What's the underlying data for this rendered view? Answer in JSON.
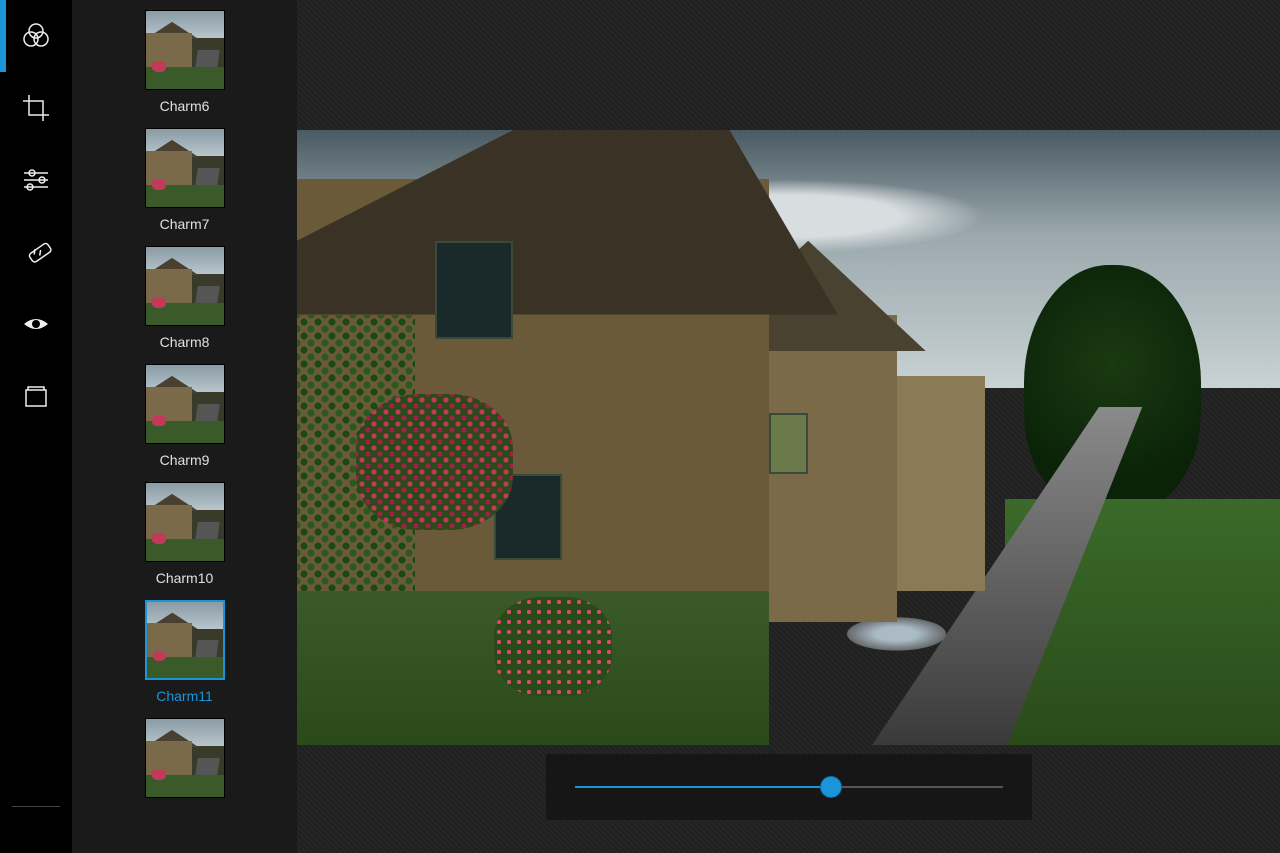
{
  "rail": {
    "items": [
      {
        "name": "filters-icon",
        "active": true
      },
      {
        "name": "crop-icon",
        "active": false
      },
      {
        "name": "adjust-icon",
        "active": false
      },
      {
        "name": "heal-icon",
        "active": false
      },
      {
        "name": "redeye-icon",
        "active": false
      },
      {
        "name": "frames-icon",
        "active": false
      }
    ],
    "bottom": {
      "name": "settings-icon"
    }
  },
  "filters": {
    "items": [
      {
        "label": "Charm6",
        "selected": false
      },
      {
        "label": "Charm7",
        "selected": false
      },
      {
        "label": "Charm8",
        "selected": false
      },
      {
        "label": "Charm9",
        "selected": false
      },
      {
        "label": "Charm10",
        "selected": false
      },
      {
        "label": "Charm11",
        "selected": true
      },
      {
        "label": "",
        "selected": false
      }
    ]
  },
  "slider": {
    "value_percent": 60
  },
  "colors": {
    "accent": "#1a95d8"
  }
}
